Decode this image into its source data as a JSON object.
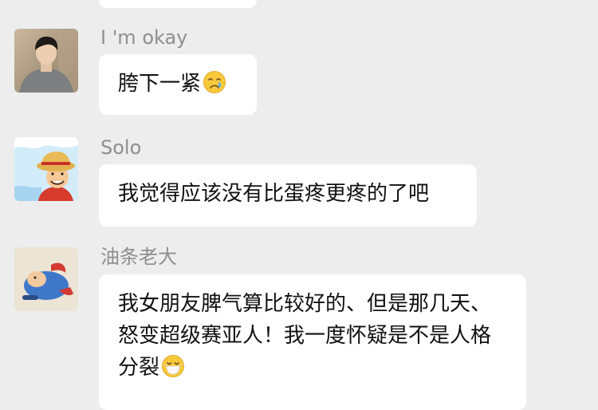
{
  "messages": [
    {
      "sender": "I 'm okay",
      "text": "胯下一紧",
      "emoji": "crying-face-icon",
      "avatar": "man-grey-sweater-avatar"
    },
    {
      "sender": "Solo",
      "text": "我觉得应该没有比蛋疼更疼的了吧",
      "avatar": "cartoon-straw-hat-avatar"
    },
    {
      "sender": "油条老大",
      "text": "我女朋友脾气算比较好的、但是那几天、怒变超级赛亚人！我一度怀疑是不是人格分裂",
      "emoji": "mask-face-icon",
      "avatar": "cartoon-figure-avatar"
    }
  ],
  "colors": {
    "background": "#ededed",
    "bubble": "#ffffff",
    "sender_name": "#8e8e8e",
    "text": "#111111"
  }
}
